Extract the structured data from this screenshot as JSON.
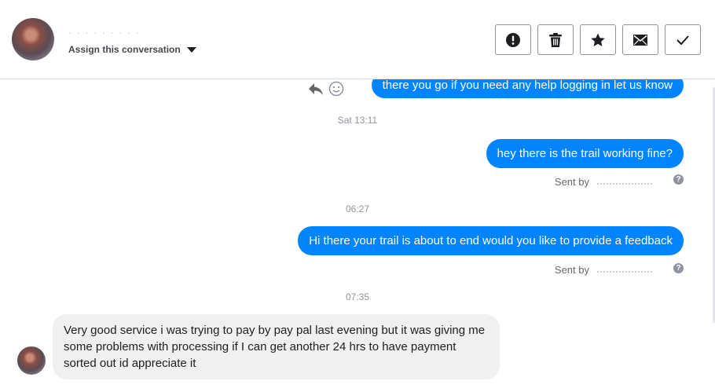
{
  "header": {
    "contact_name": "· · · · · · · · ·",
    "assign_label": "Assign this conversation"
  },
  "toolbar": [
    {
      "name": "mark-spam-button",
      "icon": "exclamation-icon"
    },
    {
      "name": "delete-button",
      "icon": "trash-icon"
    },
    {
      "name": "star-button",
      "icon": "star-icon"
    },
    {
      "name": "mark-unread-button",
      "icon": "envelope-icon"
    },
    {
      "name": "mark-done-button",
      "icon": "checkmark-icon"
    }
  ],
  "messages": {
    "m1": "there you go if you need any help logging in let us know",
    "t1": "Sat 13:11",
    "m2": "hey there is the trail working fine?",
    "m2_sentby": "Sent by",
    "t2": "06:27",
    "m3": "Hi there your trail is about to end would you like to provide a feedback",
    "m3_sentby": "Sent by",
    "t3": "07:35",
    "m4": "Very good service i was trying to pay by pay pal last evening but it was giving me some problems with processing if I can get another 24 hrs to have payment sorted out id  appreciate it"
  },
  "colors": {
    "outgoing_bubble": "#0084ff",
    "incoming_bubble": "#f0f0f0"
  }
}
